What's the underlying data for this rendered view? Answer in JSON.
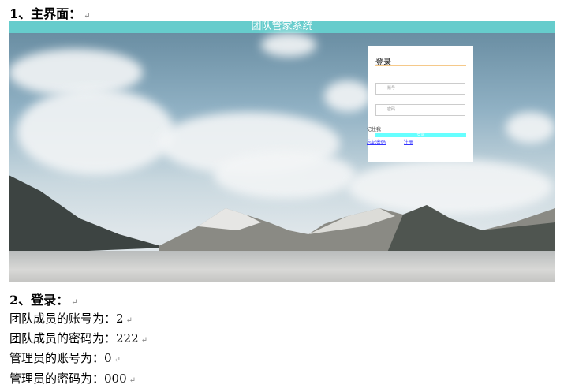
{
  "section1": "1、主界面：",
  "app": {
    "title": "团队管家系统",
    "login": {
      "title": "登录",
      "account_placeholder": "账号",
      "password_placeholder": "密码",
      "remember": "记住我",
      "login_button": "登录",
      "forgot": "忘记密码",
      "register": "注册"
    }
  },
  "section2": "2、登录：",
  "lines": [
    "团队成员的账号为：2",
    "团队成员的密码为：222",
    "管理员的账号为：0",
    "管理员的密码为：000"
  ],
  "return_mark": "↵"
}
